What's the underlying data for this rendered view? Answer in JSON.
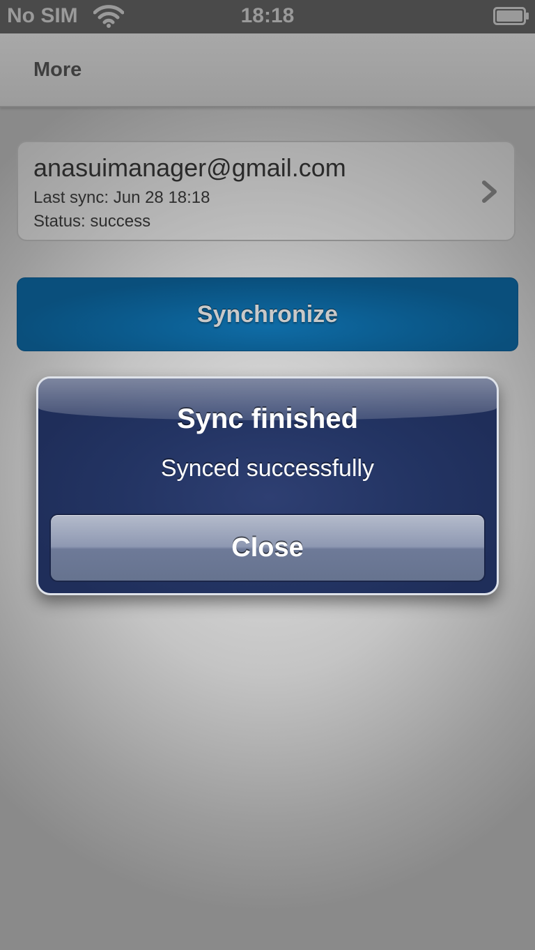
{
  "status_bar": {
    "carrier": "No SIM",
    "time": "18:18",
    "wifi_icon": "wifi-icon",
    "battery_icon": "battery-icon"
  },
  "nav": {
    "title": "More"
  },
  "account": {
    "email": "anasuimanager@gmail.com",
    "last_sync": "Last sync: Jun 28 18:18",
    "status": "Status: success",
    "chevron_icon": "chevron-right-icon"
  },
  "sync_button": {
    "label": "Synchronize"
  },
  "alert": {
    "title": "Sync finished",
    "message": "Synced successfully",
    "close_label": "Close"
  },
  "colors": {
    "sync_button": "#0b5a8c",
    "alert_background": "#233463",
    "status_bar": "#4a4a4a"
  }
}
